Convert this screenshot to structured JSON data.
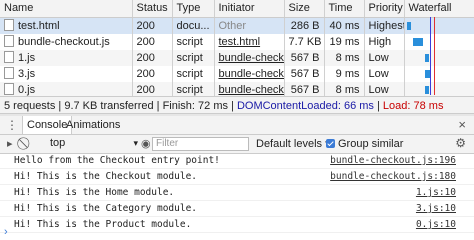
{
  "network": {
    "columns": [
      "Name",
      "Status",
      "Type",
      "Initiator",
      "Size",
      "Time",
      "Priority",
      "Waterfall"
    ],
    "rows": [
      {
        "name": "test.html",
        "status": "200",
        "type": "docu...",
        "initiator": "Other",
        "size": "286 B",
        "time": "40 ms",
        "priority": "Highest"
      },
      {
        "name": "bundle-checkout.js",
        "status": "200",
        "type": "script",
        "initiator": "test.html",
        "size": "7.7 KB",
        "time": "19 ms",
        "priority": "High"
      },
      {
        "name": "1.js",
        "status": "200",
        "type": "script",
        "initiator": "bundle-checkout...",
        "size": "567 B",
        "time": "8 ms",
        "priority": "Low"
      },
      {
        "name": "3.js",
        "status": "200",
        "type": "script",
        "initiator": "bundle-checkout...",
        "size": "567 B",
        "time": "9 ms",
        "priority": "Low"
      },
      {
        "name": "0.js",
        "status": "200",
        "type": "script",
        "initiator": "bundle-checkout...",
        "size": "567 B",
        "time": "8 ms",
        "priority": "Low"
      }
    ],
    "summary": {
      "requests": "5 requests | 9.7 KB transferred | Finish: 72 ms | ",
      "dom": "DOMContentLoaded: 66 ms",
      "sep": " | ",
      "load": "Load: 78 ms",
      "dom_color": "#1a1aa6",
      "load_color": "#c80000"
    }
  },
  "drawer": {
    "tabs": [
      "Console",
      "Animations"
    ],
    "context": "top",
    "filter_placeholder": "Filter",
    "levels": "Default levels ▾",
    "group_similar": "Group similar"
  },
  "console": {
    "messages": [
      {
        "text": "Hello from the Checkout entry point!",
        "source": "bundle-checkout.js:196"
      },
      {
        "text": "Hi! This is the Checkout module.",
        "source": "bundle-checkout.js:180"
      },
      {
        "text": "Hi! This is the Home module.",
        "source": "1.js:10"
      },
      {
        "text": "Hi! This is the Category module.",
        "source": "3.js:10"
      },
      {
        "text": "Hi! This is the Product module.",
        "source": "0.js:10"
      }
    ],
    "prompt": "›"
  }
}
